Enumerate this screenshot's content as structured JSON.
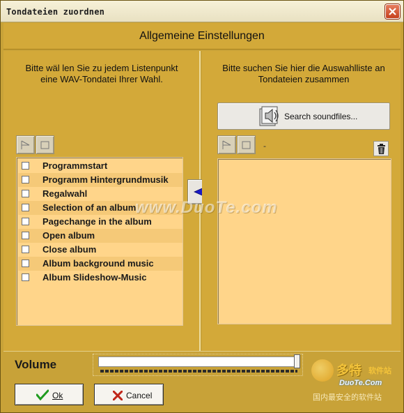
{
  "window": {
    "title": "Tondateien zuordnen"
  },
  "header": {
    "title": "Allgemeine Einstellungen"
  },
  "left_panel": {
    "instruction": "Bitte wäl len Sie zu jedem Listenpunkt eine WAV-Tondatei Ihrer Wahl.",
    "items": [
      {
        "label": "Programmstart",
        "checked": false
      },
      {
        "label": "Programm Hintergrundmusik",
        "checked": false
      },
      {
        "label": "Regalwahl",
        "checked": false
      },
      {
        "label": "Selection of an album",
        "checked": false
      },
      {
        "label": "Pagechange in the album",
        "checked": false
      },
      {
        "label": "Open album",
        "checked": false
      },
      {
        "label": "Close album",
        "checked": false
      },
      {
        "label": "Album background music",
        "checked": false
      },
      {
        "label": "Album Slideshow-Music",
        "checked": false
      }
    ]
  },
  "right_panel": {
    "instruction": "Bitte suchen Sie hier die Auswahlliste an Tondateien zusammen",
    "search_button": "Search soundfiles...",
    "selected_file": "-"
  },
  "watermark": "www.DuoTe.com",
  "volume": {
    "label": "Volume",
    "value_fraction": 0.98
  },
  "buttons": {
    "ok": "Ok",
    "cancel": "Cancel"
  },
  "logo": {
    "brand_cn": "多特",
    "brand_suffix": "软件站",
    "brand_en": "DuoTe.Com",
    "tagline": "国内最安全的软件站"
  },
  "colors": {
    "panel": "#d3a939",
    "list_bg": "#ffd58a",
    "list_alt": "#f5c978",
    "frame": "#c8a238"
  }
}
